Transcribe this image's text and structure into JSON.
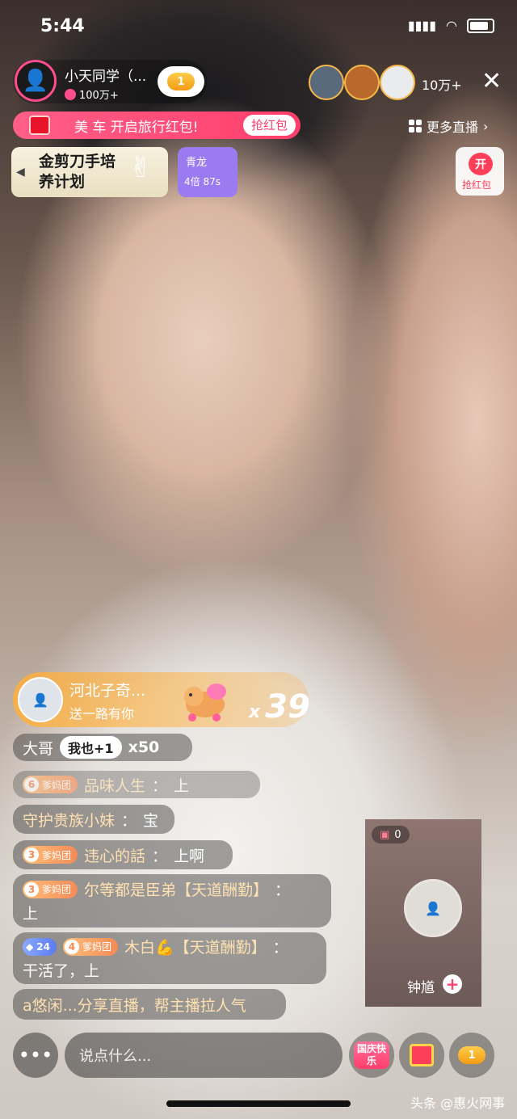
{
  "status": {
    "time": "5:44"
  },
  "host": {
    "name": "小天同学（...",
    "fans": "100万+",
    "fan_badge": "1"
  },
  "top_right": {
    "viewer_count": "10万+",
    "close": "✕",
    "more_live": "更多直播",
    "more_arrow": "›"
  },
  "promo": {
    "text": "美 车 开启旅行红包!",
    "button": "抢红包"
  },
  "banner": {
    "text": "金剪刀手培养计划",
    "arrow": "◀"
  },
  "rank": {
    "name": "青龙",
    "multiplier": "4倍 87s"
  },
  "redpack": {
    "icon_char": "开",
    "label": "抢红包"
  },
  "gift": {
    "sender": "河北子奇...",
    "desc": "送一路有你",
    "count_prefix": "x",
    "count": "39"
  },
  "comments": [
    {
      "user": "大哥",
      "tag": "我也+1",
      "text": "x50"
    },
    {
      "level": "6",
      "group": "爹妈团",
      "user": "品味人生",
      "sep": "：",
      "text": "上"
    },
    {
      "user": "守护贵族小妹",
      "sep": "：",
      "text": "宝"
    },
    {
      "level": "3",
      "group": "爹妈团",
      "user": "违心的話",
      "sep": "：",
      "text": "上啊"
    },
    {
      "level": "3",
      "group": "爹妈团",
      "user": "尔等都是臣弟【天道酬勤】",
      "sep": "：",
      "text": "上"
    },
    {
      "level_blue": "24",
      "level": "4",
      "group": "爹妈团",
      "user": "木白💪【天道酬勤】",
      "sep": "：",
      "text": "干活了，上"
    },
    {
      "text": "a悠闲...分享直播，帮主播拉人气"
    }
  ],
  "pip": {
    "count": "0",
    "name": "钟馗",
    "plus": "+"
  },
  "bottom": {
    "more": "•••",
    "placeholder": "说点什么...",
    "fest_label": "国庆快乐",
    "fan_level": "1"
  },
  "watermark": "头条 @惠火网事",
  "colors": {
    "accent": "#ff3e6c",
    "gold": "#f39b12"
  }
}
